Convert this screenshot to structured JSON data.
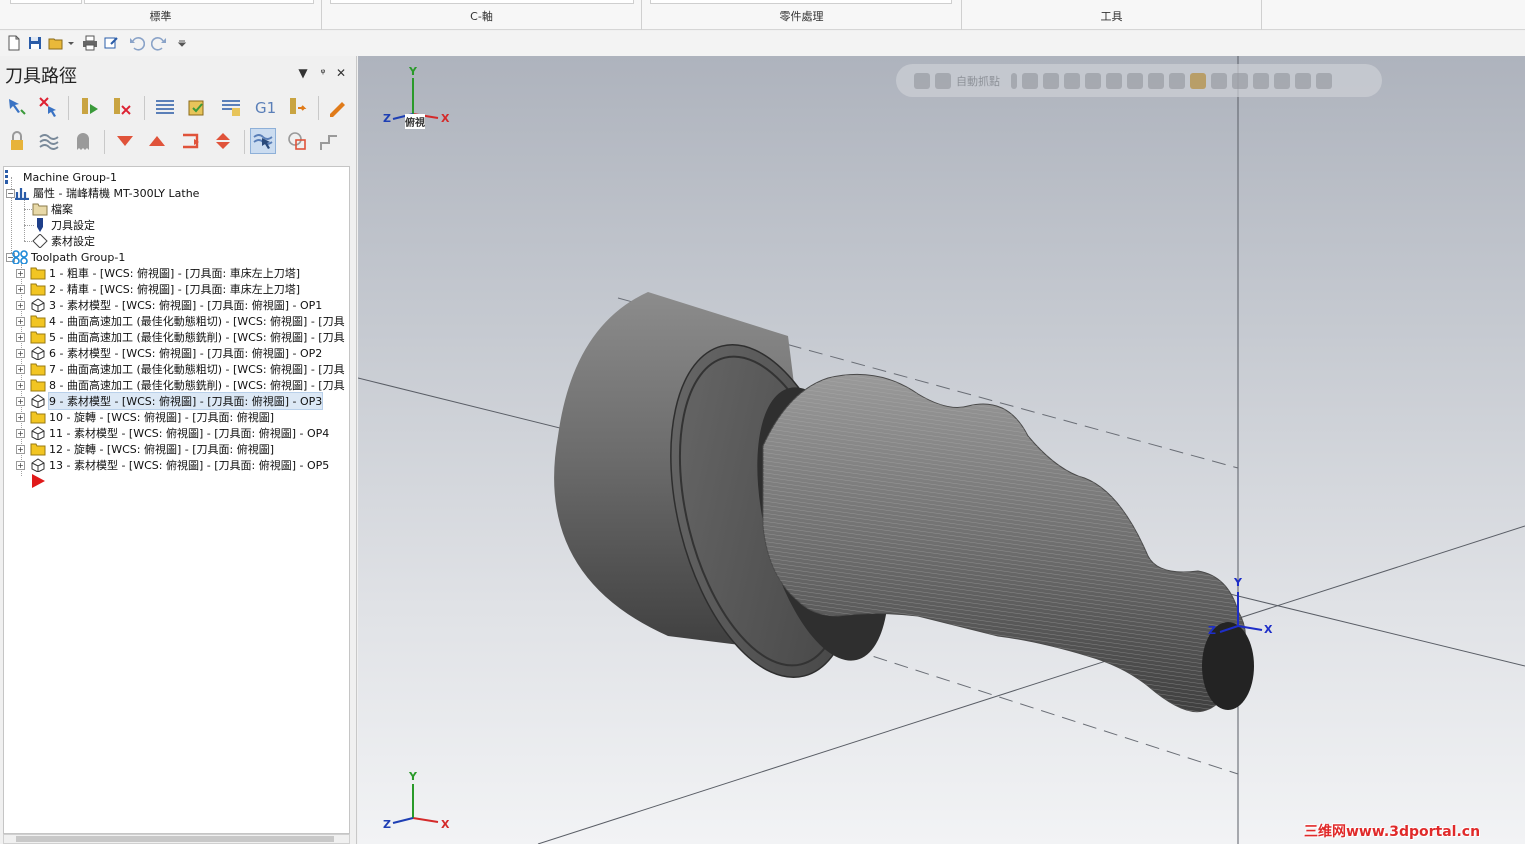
{
  "ribbon": {
    "groups": [
      {
        "label": "標準"
      },
      {
        "label": "C-軸"
      },
      {
        "label": "零件處理"
      },
      {
        "label": "工具"
      }
    ]
  },
  "panel": {
    "title": "刀具路徑",
    "controls": [
      "▼",
      "ᵠ",
      "✕"
    ]
  },
  "tree": {
    "nodes": [
      {
        "label": "Machine Group-1",
        "icon": "machine-group-icon"
      },
      {
        "label": "屬性 - 瑞峰精機 MT-300LY Lathe",
        "icon": "properties-icon"
      },
      {
        "label": "檔案",
        "icon": "folder-icon"
      },
      {
        "label": "刀具設定",
        "icon": "tool-settings-icon"
      },
      {
        "label": "素材設定",
        "icon": "stock-settings-icon"
      },
      {
        "label": "Toolpath Group-1",
        "icon": "toolpath-group-icon"
      },
      {
        "label": "1 - 粗車 - [WCS: 俯視圖] - [刀具面: 車床左上刀塔]",
        "icon": "folder-icon"
      },
      {
        "label": "2 - 精車 - [WCS: 俯視圖] - [刀具面: 車床左上刀塔]",
        "icon": "folder-icon"
      },
      {
        "label": "3 - 素材模型 - [WCS: 俯視圖] - [刀具面: 俯視圖] - OP1",
        "icon": "stock-model-icon"
      },
      {
        "label": "4 - 曲面高速加工 (最佳化動態粗切) - [WCS: 俯視圖] - [刀具",
        "icon": "folder-icon"
      },
      {
        "label": "5 - 曲面高速加工 (最佳化動態銑削) - [WCS: 俯視圖] - [刀具",
        "icon": "folder-icon"
      },
      {
        "label": "6 - 素材模型 - [WCS: 俯視圖] - [刀具面: 俯視圖] - OP2",
        "icon": "stock-model-icon"
      },
      {
        "label": "7 - 曲面高速加工 (最佳化動態粗切) - [WCS: 俯視圖] - [刀具",
        "icon": "folder-icon"
      },
      {
        "label": "8 - 曲面高速加工 (最佳化動態銑削) - [WCS: 俯視圖] - [刀具",
        "icon": "folder-icon"
      },
      {
        "label": "9 - 素材模型 - [WCS: 俯視圖] - [刀具面: 俯視圖] - OP3",
        "icon": "stock-model-icon"
      },
      {
        "label": "10 - 旋轉 - [WCS: 俯視圖] - [刀具面: 俯視圖]",
        "icon": "folder-icon"
      },
      {
        "label": "11 - 素材模型 - [WCS: 俯視圖] - [刀具面: 俯視圖] - OP4",
        "icon": "stock-model-icon"
      },
      {
        "label": "12 - 旋轉 - [WCS: 俯視圖] - [刀具面: 俯視圖]",
        "icon": "folder-icon"
      },
      {
        "label": "13 - 素材模型 - [WCS: 俯視圖] - [刀具面: 俯視圖] - OP5",
        "icon": "stock-model-icon"
      }
    ],
    "selected_label": "9 - 素材模型 - [WCS: 俯視圖] - [刀具面: 俯視圖] - OP3"
  },
  "viewport": {
    "snap_label": "自動抓點",
    "gnomon_top": {
      "x": "X",
      "y": "Y",
      "z": "Z",
      "view": "俯視"
    },
    "gnomon_bottom": {
      "x": "X",
      "y": "Y",
      "z": "Z"
    },
    "wcs": {
      "x": "X",
      "y": "Y",
      "z": "Z"
    },
    "watermark": "三维网www.3dportal.cn"
  },
  "colors": {
    "accent": "#1e5fb4",
    "axis_x": "#d42a2a",
    "axis_y": "#2a9a2a",
    "axis_z": "#1e3fb4",
    "folder": "#f2c522",
    "part": "#5a5a5a"
  }
}
